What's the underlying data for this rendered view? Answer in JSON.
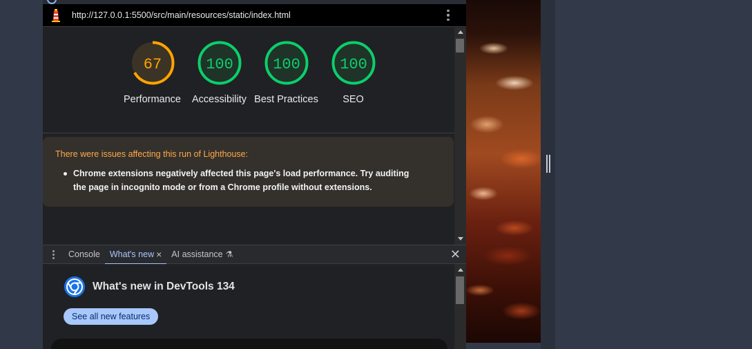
{
  "browser": {
    "url": "http://127.0.0.1:5500/src/main/resources/static/index.html"
  },
  "lighthouse": {
    "scores": [
      {
        "value": "67",
        "label": "Performance",
        "color": "#ffa400",
        "fraction": 0.67
      },
      {
        "value": "100",
        "label": "Accessibility",
        "color": "#0cce6b",
        "fraction": 1.0
      },
      {
        "value": "100",
        "label": "Best Practices",
        "color": "#0cce6b",
        "fraction": 1.0
      },
      {
        "value": "100",
        "label": "SEO",
        "color": "#0cce6b",
        "fraction": 1.0
      }
    ],
    "warning": {
      "title": "There were issues affecting this run of Lighthouse:",
      "items": [
        "Chrome extensions negatively affected this page's load performance. Try auditing the page in incognito mode or from a Chrome profile without extensions."
      ]
    }
  },
  "drawer": {
    "tabs": [
      {
        "label": "Console",
        "active": false
      },
      {
        "label": "What's new",
        "active": true,
        "closable": true
      },
      {
        "label": "AI assistance",
        "active": false,
        "icon": "flask-icon"
      }
    ],
    "whats_new": {
      "title": "What's new in DevTools 134",
      "button": "See all new features"
    }
  },
  "icons": {
    "close": "✕",
    "tab_close": "×",
    "flask": "⚗"
  }
}
